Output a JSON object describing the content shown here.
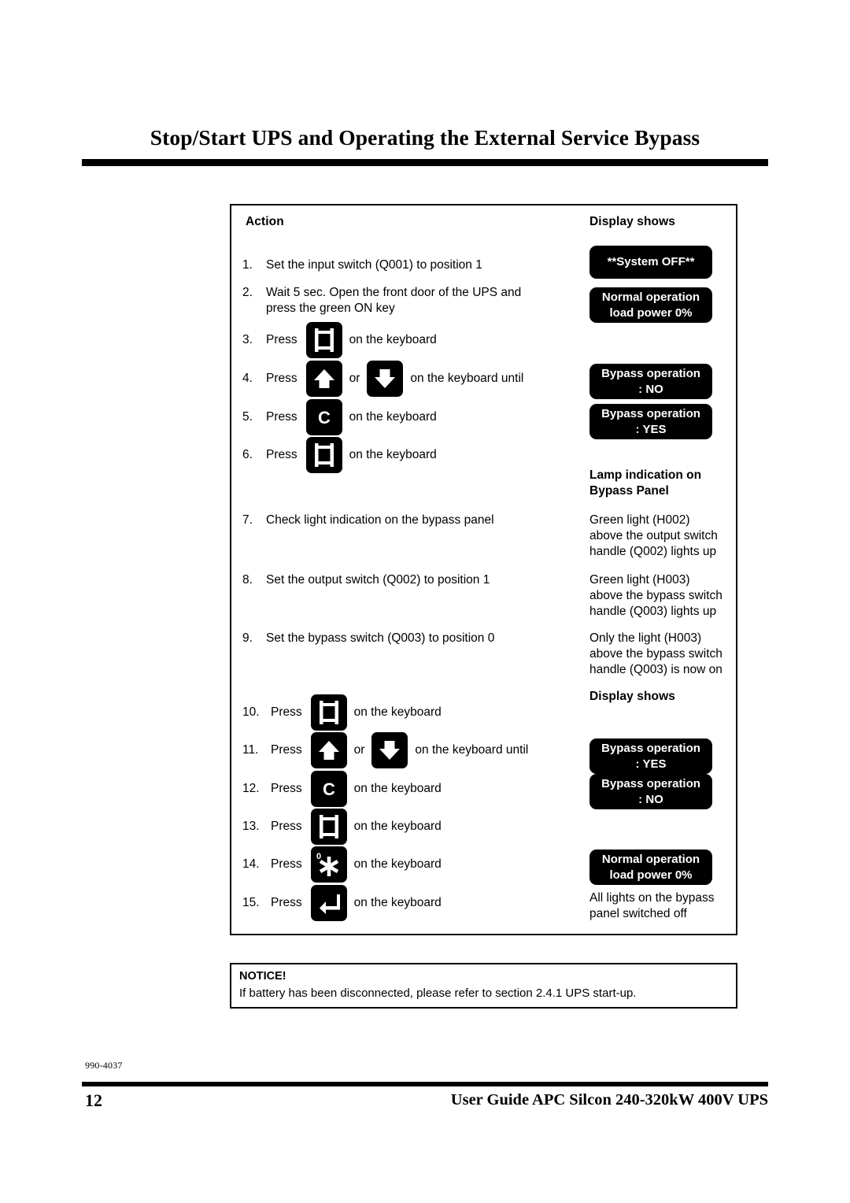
{
  "document": {
    "page_title": "Stop/Start UPS and Operating the External Service Bypass",
    "doc_code": "990-4037",
    "page_number": "12",
    "footer_title": "User Guide APC Silcon 240-320kW 400V UPS"
  },
  "table": {
    "headers": {
      "action": "Action",
      "display": "Display shows",
      "display_2": "Display shows",
      "lamp": "Lamp indication on\nBypass Panel"
    },
    "steps": [
      {
        "num": "1.",
        "pre": "Set the input switch (Q001) to position 1",
        "key": null,
        "post": ""
      },
      {
        "num": "2.",
        "pre": "Wait 5 sec. Open the front door of the UPS and\npress the green ON key",
        "key": null,
        "post": ""
      },
      {
        "num": "3.",
        "pre": "Press",
        "key": "menu-key",
        "post": "on the keyboard"
      },
      {
        "num": "4.",
        "pre": "Press",
        "key": "up-arrow-key",
        "mid": "or",
        "key2": "down-arrow-key",
        "post": "on the keyboard until"
      },
      {
        "num": "5.",
        "pre": "Press",
        "key": "c-key",
        "post": "on the keyboard"
      },
      {
        "num": "6.",
        "pre": "Press",
        "key": "menu-key",
        "post": "on the keyboard"
      },
      {
        "num": "7.",
        "pre": "Check light indication on the bypass panel",
        "key": null,
        "post": ""
      },
      {
        "num": "8.",
        "pre": "Set the output switch (Q002) to position 1",
        "key": null,
        "post": ""
      },
      {
        "num": "9.",
        "pre": "Set the bypass switch (Q003) to position 0",
        "key": null,
        "post": ""
      },
      {
        "num": "10.",
        "pre": "Press",
        "key": "menu-key",
        "post": "on the keyboard"
      },
      {
        "num": "11.",
        "pre": "Press",
        "key": "up-arrow-key",
        "mid": "or",
        "key2": "down-arrow-key",
        "post": "on the keyboard until"
      },
      {
        "num": "12.",
        "pre": "Press",
        "key": "c-key",
        "post": "on the keyboard"
      },
      {
        "num": "13.",
        "pre": "Press",
        "key": "menu-key",
        "post": "on the keyboard"
      },
      {
        "num": "14.",
        "pre": "Press",
        "key": "asterisk-zero-key",
        "post": "on the keyboard"
      },
      {
        "num": "15.",
        "pre": "Press",
        "key": "enter-key",
        "post": "on the keyboard"
      }
    ],
    "displays": [
      {
        "id": "d1",
        "line1": "**System OFF**",
        "line2": ""
      },
      {
        "id": "d2",
        "line1": "Normal operation",
        "line2": "load power 0%"
      },
      {
        "id": "d3",
        "line1": "Bypass operation",
        "line2": ":  NO"
      },
      {
        "id": "d4",
        "line1": "Bypass operation",
        "line2": ":  YES"
      },
      {
        "id": "d5",
        "line1": "Bypass operation",
        "line2": ":  YES"
      },
      {
        "id": "d6",
        "line1": "Bypass operation",
        "line2": ":  NO"
      },
      {
        "id": "d7",
        "line1": "Normal operation",
        "line2": "load power 0%"
      }
    ],
    "notes": [
      {
        "id": "n1",
        "text": "Green light (H002)\nabove the output switch\nhandle (Q002) lights up"
      },
      {
        "id": "n2",
        "text": "Green light (H003)\nabove the bypass switch\nhandle (Q003) lights up"
      },
      {
        "id": "n3",
        "text": "Only the light (H003)\nabove the bypass switch\nhandle (Q003) is now on"
      },
      {
        "id": "n4",
        "text": "All lights on the bypass\npanel switched off"
      }
    ]
  },
  "notice": {
    "title": "NOTICE!",
    "body": "If battery has been disconnected, please refer to section 2.4.1 UPS start-up."
  },
  "colors": {
    "ink": "#000000",
    "paper": "#ffffff",
    "lcd_background": "#000000",
    "lcd_text": "#ffffff"
  }
}
